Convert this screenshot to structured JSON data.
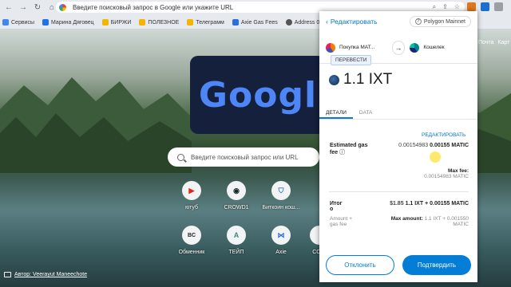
{
  "browser": {
    "omnibox_placeholder": "Введите поисковый запрос в Google или укажите URL",
    "bookmarks": [
      {
        "label": "Сервисы",
        "color": "#4285f4"
      },
      {
        "label": "Марина Дяговец",
        "color": "#1a73e8"
      },
      {
        "label": "БИРЖИ",
        "color": "#f2b600"
      },
      {
        "label": "ПОЛЕЗНОЕ",
        "color": "#f2b600"
      },
      {
        "label": "Телеграмм",
        "color": "#f2b600"
      },
      {
        "label": "Axie Gas Fees",
        "color": "#2b6ede"
      },
      {
        "label": "Address 0x4",
        "color": "#555555"
      }
    ]
  },
  "ntp": {
    "doodle_text": "Googl",
    "search_placeholder": "Введите поисковый запрос или URL",
    "tiles": [
      {
        "label": "ютуб",
        "icon": "youtube-icon",
        "glyph": "▶",
        "color": "#e62117"
      },
      {
        "label": "CROWD1",
        "icon": "crowd1-icon",
        "glyph": "◉",
        "color": "#1a2a2a"
      },
      {
        "label": "Биткоин кош...",
        "icon": "bitcoin-wallet-icon",
        "glyph": "⛉",
        "color": "#2a7bc4"
      },
      {
        "label": "Обменник",
        "icon": "exchanger-icon",
        "glyph": "BC",
        "color": "#222222"
      },
      {
        "label": "ТЕЙП",
        "icon": "teip-icon",
        "glyph": "A",
        "color": "#3c8f6a"
      },
      {
        "label": "Axie",
        "icon": "axie-icon",
        "glyph": "⋈",
        "color": "#2b6ede"
      },
      {
        "label": "COIN",
        "icon": "coin-icon",
        "glyph": "",
        "color": "#444444"
      }
    ],
    "author": "Автор: Veerayut Maneechote",
    "right_links": [
      "Почта",
      "Карт"
    ]
  },
  "wallet": {
    "edit_label": "Редактировать",
    "network": "Polygon Mainnet",
    "from_account": "Покупка МАТ...",
    "to_account": "Кошелек",
    "method_badge": "ПЕРЕВЕСТИ",
    "amount": "1.1 IXT",
    "tabs": [
      "ДЕТАЛИ",
      "DATA"
    ],
    "edit_fee_label": "РЕДАКТИРОВАТЬ",
    "estimated_label": "Estimated gas fee",
    "estimated_value": "0.00154983",
    "estimated_value_bold": "0.00155 MATIC",
    "max_fee_label": "Max fee:",
    "max_fee_value": "0.00154983 MATIC",
    "total_label": "Итог",
    "total_label_2": "о",
    "total_usd": "$1.85",
    "total_value": "1.1 IXT + 0.00155 MATIC",
    "total_sub": "Amount + gas fee",
    "max_amount_label": "Max amount:",
    "max_amount_value": "1.1 IXT + 0.001550 MATIC",
    "reject_label": "Отклонить",
    "confirm_label": "Подтвердить"
  }
}
